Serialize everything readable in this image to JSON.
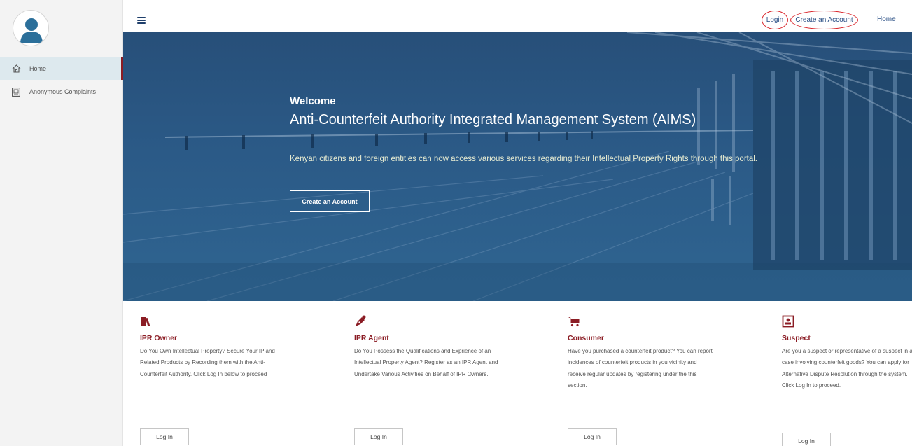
{
  "sidebar": {
    "items": [
      {
        "label": "Home",
        "icon": "home-icon",
        "active": true
      },
      {
        "label": "Anonymous Complaints",
        "icon": "complaints-icon",
        "active": false
      }
    ]
  },
  "topbar": {
    "login_label": "Login",
    "create_account_label": "Create an Account",
    "home_label": "Home"
  },
  "hero": {
    "welcome": "Welcome",
    "title": "Anti-Counterfeit Authority Integrated Management System (AIMS)",
    "description": "Kenyan citizens and foreign entities can now access various services regarding their Intellectual Property Rights through this portal.",
    "button_label": "Create an Account"
  },
  "cards": [
    {
      "icon": "books-icon",
      "title": "IPR Owner",
      "text": "Do You Own Intellectual Property? Secure Your IP and Related Products by Recording them with the Anti-Counterfeit Authority. Click Log In below to proceed",
      "button_label": "Log In"
    },
    {
      "icon": "pen-nib-icon",
      "title": "IPR Agent",
      "text": "Do You Possess the Qualifications and Exprience of an Intellectual Property Agent? Register as an IPR Agent and Undertake Various Activities on Behalf of IPR Owners.",
      "button_label": "Log In"
    },
    {
      "icon": "cart-icon",
      "title": "Consumer",
      "text": "Have you purchased a counterfeit product? You can report incidences of counterfeit products in you vicinity and receive regular updates by registering under the this section.",
      "button_label": "Log In"
    },
    {
      "icon": "id-badge-icon",
      "title": "Suspect",
      "text": "Are you a suspect or representative of a suspect in a case involving counterfeit goods? You can apply for Alternative Dispute Resolution through the system. Click Log In to proceed.",
      "button_label": "Log In"
    }
  ],
  "colors": {
    "accent": "#8b1c24",
    "link": "#2a4f85",
    "hero_bg": "#2b5a87",
    "highlight_circle": "#d9262c"
  }
}
